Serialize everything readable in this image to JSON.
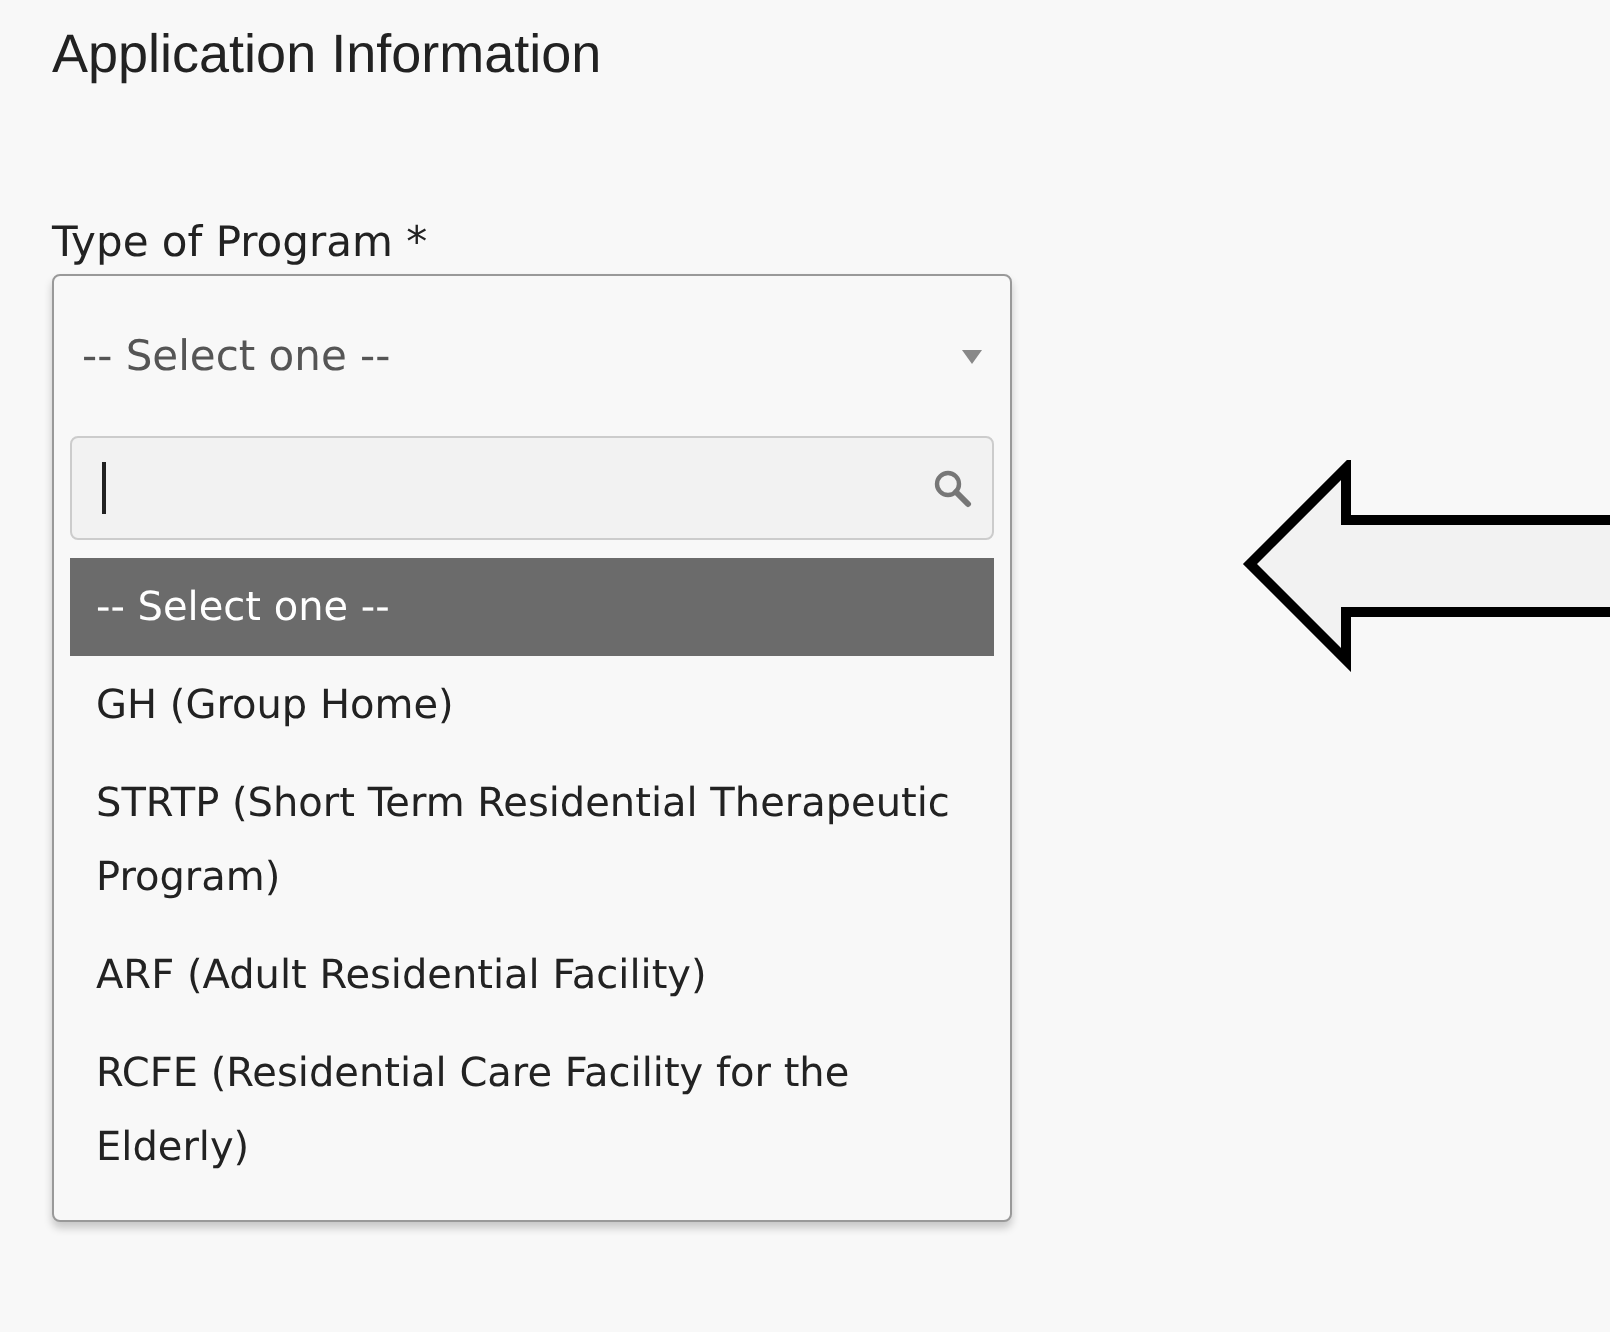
{
  "section": {
    "title": "Application Information"
  },
  "field": {
    "label": "Type of Program *",
    "value": "-- Select one --",
    "expanded": true
  },
  "options": [
    {
      "label": "-- Select one --",
      "selected": true
    },
    {
      "label": "GH (Group Home)",
      "selected": false
    },
    {
      "label": "STRTP (Short Term Residential Therapeutic Program)",
      "selected": false
    },
    {
      "label": "ARF (Adult Residential Facility)",
      "selected": false
    },
    {
      "label": "RCFE (Residential Care Facility for the Elderly)",
      "selected": false
    }
  ]
}
